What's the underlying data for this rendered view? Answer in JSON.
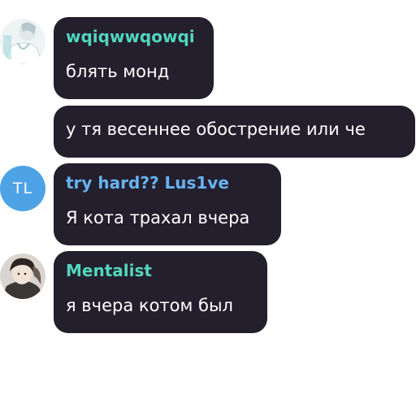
{
  "messages": [
    {
      "sender": "wqiqwwqowqi",
      "sender_color": "#52d6bd",
      "text": "блять монд",
      "avatar": {
        "type": "image",
        "icon": "anime-nurse-avatar-icon"
      }
    },
    {
      "text": "у тя весеннее обострение или че"
    },
    {
      "sender": "try hard?? Lus1ve",
      "sender_color": "#66b3f2",
      "text": "Я кота трахал вчера",
      "avatar": {
        "type": "initials",
        "initials": "TL",
        "color": "#4da3e6"
      }
    },
    {
      "sender": "Mentalist",
      "sender_color": "#52d6bd",
      "text": "я вчера котом был",
      "avatar": {
        "type": "image",
        "icon": "anime-man-avatar-icon"
      }
    }
  ],
  "colors": {
    "bubble_background": "#241f2d",
    "message_text": "#ffffff",
    "page_background": "#ffffff"
  }
}
